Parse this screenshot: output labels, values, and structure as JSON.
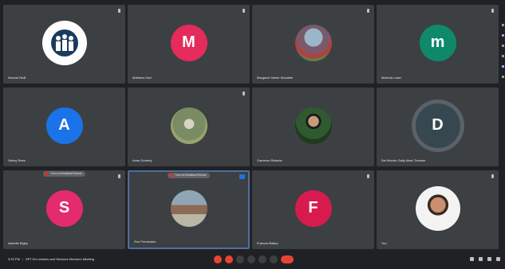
{
  "participants": [
    {
      "name": "Nomad HAB",
      "avatar_letter": "",
      "avatar_color": "#ffffff",
      "avatar_kind": "logo-icon"
    },
    {
      "name": "Matthew Hart",
      "avatar_letter": "M",
      "avatar_color": "#e52b5b",
      "avatar_kind": "letter"
    },
    {
      "name": "Margaret Steele Schaefer",
      "avatar_letter": "",
      "avatar_color": "",
      "avatar_kind": "group-photo"
    },
    {
      "name": "Melinda Lasiri",
      "avatar_letter": "m",
      "avatar_color": "#0e8a6b",
      "avatar_kind": "letter"
    },
    {
      "name": "Sahoy Rees",
      "avatar_letter": "A",
      "avatar_color": "#1a73e8",
      "avatar_kind": "letter"
    },
    {
      "name": "Anne Doherty",
      "avatar_letter": "",
      "avatar_color": "",
      "avatar_kind": "outdoor-photo"
    },
    {
      "name": "Cameron Roberts",
      "avatar_letter": "",
      "avatar_color": "",
      "avatar_kind": "person-photo"
    },
    {
      "name": "Del Mundo Galip Mark Therese",
      "avatar_letter": "D",
      "avatar_color": "#37474f",
      "avatar_kind": "letter"
    },
    {
      "name": "Isabelle Bigby",
      "avatar_letter": "S",
      "avatar_color": "#e52b6b",
      "avatar_kind": "letter",
      "banner": "Turn on Breakout Rooms"
    },
    {
      "name": "Sun Fernandez",
      "avatar_letter": "",
      "avatar_color": "",
      "avatar_kind": "water-photo",
      "banner": "Turn on Breakout Rooms"
    },
    {
      "name": "Frances Bailey",
      "avatar_letter": "F",
      "avatar_color": "#d81b4f",
      "avatar_kind": "letter"
    },
    {
      "name": "You",
      "avatar_letter": "",
      "avatar_color": "",
      "avatar_kind": "man-photo"
    }
  ],
  "bottom_bar": {
    "time": "3:23 PM",
    "separator": "|",
    "meeting_title": "SPT Ed Leaders and Services Directors Meeting"
  },
  "colors": {
    "background": "#202124",
    "tile": "#3c4043",
    "accent": "#1a73e8",
    "end_call": "#ea4335"
  }
}
